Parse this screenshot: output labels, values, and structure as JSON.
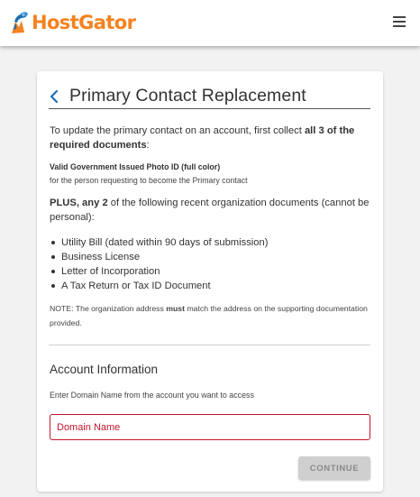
{
  "header": {
    "logo_text": "HostGator",
    "brand_color": "#f5821f",
    "menu_icon": "hamburger-menu-icon"
  },
  "card": {
    "back_icon": "chevron-left-icon",
    "title": "Primary Contact Replacement",
    "intro": {
      "text": "To update the primary contact on an account, first collect ",
      "bold": "all 3 of the required documents",
      "suffix": ":"
    },
    "id_requirement": {
      "title": "Valid Government Issued Photo ID (full color)",
      "subtitle": "for the person requesting to become the Primary contact"
    },
    "plus": {
      "bold": "PLUS, any 2",
      "text": " of the following recent organization documents (cannot be personal):"
    },
    "documents": [
      "Utility Bill (dated within 90 days of submission)",
      "Business License",
      "Letter of Incorporation",
      "A Tax Return or Tax ID Document"
    ],
    "note": {
      "prefix": "NOTE: The organization address ",
      "bold": "must",
      "suffix": " match the address on the supporting documentation provided."
    },
    "account_section": {
      "title": "Account Information",
      "help": "Enter Domain Name from the account you want to access",
      "domain_placeholder": "Domain Name",
      "domain_value": "",
      "error_color": "#c4162a"
    },
    "continue_label": "CONTINUE"
  }
}
